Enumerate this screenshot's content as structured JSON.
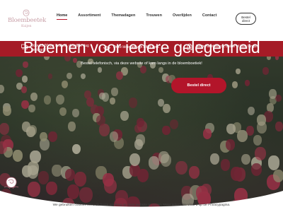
{
  "brand": {
    "name": "Bloembeetek",
    "sub": "Kuijen"
  },
  "nav": {
    "items": [
      {
        "label": "Home",
        "active": true
      },
      {
        "label": "Assortiment",
        "active": false
      },
      {
        "label": "Themadagen",
        "active": false
      },
      {
        "label": "Trouwen",
        "active": false
      },
      {
        "label": "Overlijden",
        "active": false
      },
      {
        "label": "Contact",
        "active": false
      }
    ]
  },
  "header_button": {
    "line1": "Bestel",
    "line2": "direct"
  },
  "usp": [
    {
      "icon": "truck-icon",
      "text": "Voor 12:00 uur besteld, dezelfde dag bezorgd."
    },
    {
      "icon": "lotus-icon",
      "text": "Onze bloemen zijn altijd vers."
    },
    {
      "icon": "shopping-bag-icon",
      "text": "Bestel telefonisch, online of kom langs!"
    }
  ],
  "hero": {
    "title": "Bloemen voor iedere gelegenheid",
    "subtitle": "Bestel telefonisch, via deze website of kom langs in de bloemboetiek!",
    "button": "Bestel direct"
  },
  "cookie": "We gebruiken cookies om u de beste ervaring op onze website te geven. Meer informatie vindt u op de Privacypagina.",
  "colors": {
    "accent": "#a51b26",
    "button": "#b3152a",
    "logo": "#c9a0a8"
  }
}
